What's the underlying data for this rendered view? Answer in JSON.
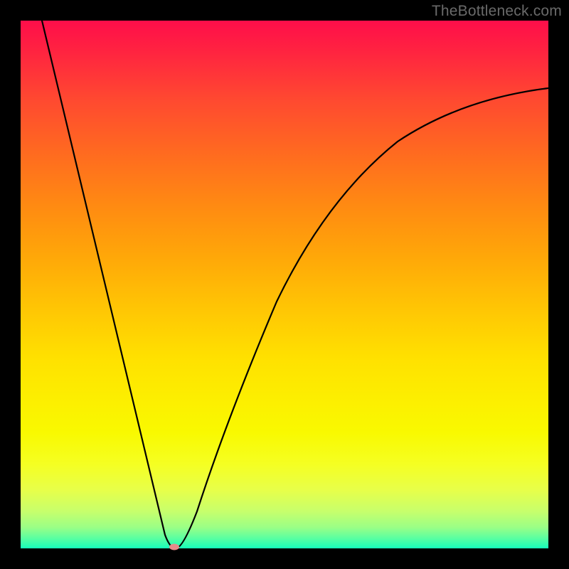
{
  "watermark": "TheBottleneck.com",
  "colors": {
    "frame_border": "#000000",
    "curve_stroke": "#000000",
    "marker_fill": "#e68a8a",
    "gradient_top": "#ff0e4a",
    "gradient_bottom": "#16ffba"
  },
  "chart_data": {
    "type": "line",
    "title": "",
    "xlabel": "",
    "ylabel": "",
    "xlim": [
      0,
      100
    ],
    "ylim": [
      0,
      100
    ],
    "grid": false,
    "legend": false,
    "series": [
      {
        "name": "bottleneck-curve",
        "x": [
          4,
          7,
          10,
          13,
          16,
          19,
          22,
          24.5,
          26,
          27.5,
          29,
          31,
          33,
          36,
          40,
          45,
          50,
          56,
          63,
          71,
          80,
          90,
          100
        ],
        "y": [
          100,
          87,
          75,
          62,
          50,
          37,
          25,
          14,
          7,
          2,
          0,
          5,
          13,
          24,
          36,
          48,
          57,
          65,
          72,
          78,
          82.5,
          85.5,
          87
        ]
      }
    ],
    "marker": {
      "x": 29,
      "y": 0
    },
    "notes": "Axes have no visible ticks or labels; y-values estimated from vertical position relative to plot-area height; valley minimum (marker) at roughly x≈29%."
  }
}
